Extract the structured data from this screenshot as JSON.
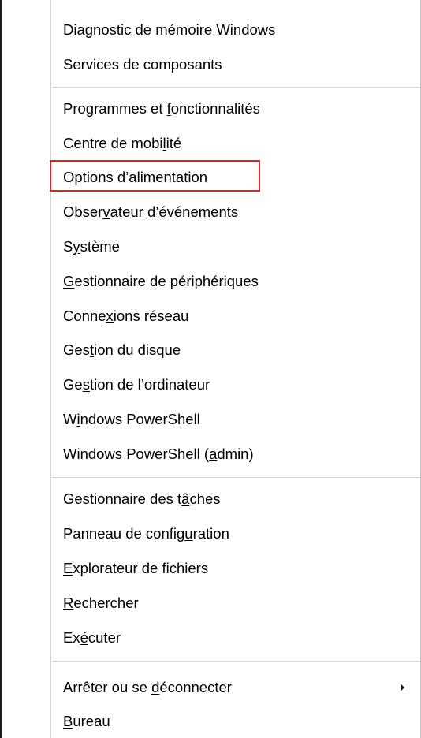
{
  "menu": {
    "items": [
      {
        "pre": "Diagnostic de mémoire Windows",
        "ul": "",
        "post": ""
      },
      {
        "pre": "Services de composants",
        "ul": "",
        "post": ""
      },
      {
        "pre": "Programmes et ",
        "ul": "f",
        "post": "onctionnalités"
      },
      {
        "pre": "Centre de mobi",
        "ul": "l",
        "post": "ité"
      },
      {
        "pre": "",
        "ul": "O",
        "post": "ptions d’alimentation"
      },
      {
        "pre": "Obser",
        "ul": "v",
        "post": "ateur d’événements"
      },
      {
        "pre": "S",
        "ul": "y",
        "post": "stème"
      },
      {
        "pre": "",
        "ul": "G",
        "post": "estionnaire de périphériques"
      },
      {
        "pre": "Conne",
        "ul": "x",
        "post": "ions réseau"
      },
      {
        "pre": "Ges",
        "ul": "t",
        "post": "ion du disque"
      },
      {
        "pre": "Ge",
        "ul": "s",
        "post": "tion de l’ordinateur"
      },
      {
        "pre": "W",
        "ul": "i",
        "post": "ndows PowerShell"
      },
      {
        "pre": "Windows PowerShell (",
        "ul": "a",
        "post": "dmin)"
      },
      {
        "pre": "Gestionnaire des t",
        "ul": "â",
        "post": "ches"
      },
      {
        "pre": "Panneau de config",
        "ul": "u",
        "post": "ration"
      },
      {
        "pre": "",
        "ul": "E",
        "post": "xplorateur de fichiers"
      },
      {
        "pre": "",
        "ul": "R",
        "post": "echercher"
      },
      {
        "pre": "Ex",
        "ul": "é",
        "post": "cuter"
      },
      {
        "pre": "Arrêter ou se ",
        "ul": "d",
        "post": "éconnecter"
      },
      {
        "pre": "",
        "ul": "B",
        "post": "ureau"
      }
    ]
  },
  "highlight": {
    "color": "#e61e1e",
    "item_index": 4
  },
  "icons": {
    "submenu_arrow": "chevron-right-icon"
  }
}
